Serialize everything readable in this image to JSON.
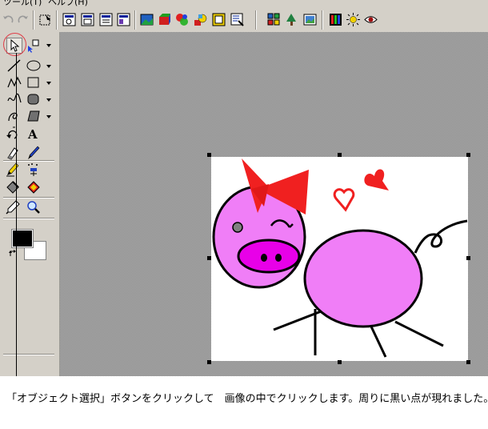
{
  "menu": {
    "items": [
      "ツール(T)",
      "ヘルプ(H)"
    ]
  },
  "toolbar": {
    "buttons": [
      "undo-icon",
      "redo-icon",
      "select-all-icon",
      "view-icon-1",
      "view-icon-2",
      "view-icon-3",
      "view-icon-4",
      "picture-icon",
      "effect-icon",
      "shape-icon",
      "text-color-icon",
      "frame-icon",
      "canvas-icon",
      "thumbnails-icon",
      "tree-icon",
      "image-icon",
      "color-balance-icon",
      "brightness-icon",
      "eye-icon"
    ]
  },
  "toolbox": {
    "tools": [
      "object-select-tool",
      "object-transform-tool",
      "line-tool",
      "ellipse-tool",
      "polyline-tool",
      "rectangle-tool",
      "freehand-tool",
      "rounded-rectangle-tool",
      "curve-tool",
      "polygon-tool",
      "rotate-tool",
      "text-tool",
      "eraser-tool",
      "brush-tool",
      "pen-tool",
      "airbrush-tool",
      "fill-tool",
      "stamp-tool",
      "eyedropper-tool",
      "zoom-tool"
    ],
    "foreground_color": "#000000",
    "background_color": "#ffffff"
  },
  "annotation": {
    "caption": "「オブジェクト選択」ボタンをクリックして　画像の中でクリックします。周りに黒い点が現れました。",
    "callout_color": "#e0404a"
  },
  "colors": {
    "pig_pink": "#f07ef7",
    "nose_magenta": "#e800e8",
    "bow_red": "#f02020"
  }
}
